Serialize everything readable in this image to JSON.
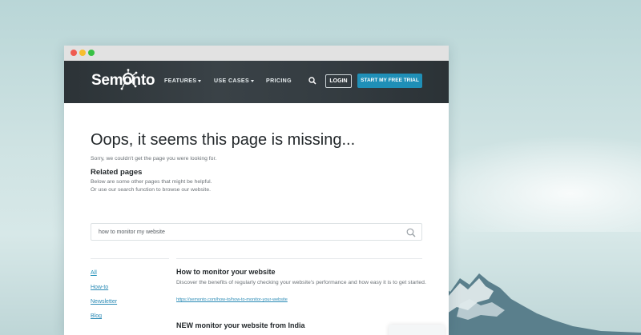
{
  "nav": {
    "brand": "Semonto",
    "features": "FEATURES",
    "use_cases": "USE CASES",
    "pricing": "PRICING",
    "login": "LOGIN",
    "trial": "START MY FREE TRIAL",
    "icons": [
      "logo-network-icon",
      "search-icon",
      "chevron-down-icon"
    ]
  },
  "page": {
    "title": "Oops, it seems this page is missing...",
    "sorry": "Sorry, we couldn't get the page you were looking for.",
    "related_heading": "Related pages",
    "related_line1": "Below are some other pages that might be helpful.",
    "related_line2": "Or use our search function to browse our website."
  },
  "search": {
    "value": "how to monitor my website"
  },
  "filters": [
    {
      "label": "All"
    },
    {
      "label": "How-to"
    },
    {
      "label": "Newsletter"
    },
    {
      "label": "Blog"
    }
  ],
  "results": [
    {
      "title": "How to monitor your website",
      "description": "Discover the benefits of regularly checking your website's performance and how easy it is to get started.",
      "url": "https://semonto.com/how-to/how-to-monitor-your-website"
    },
    {
      "title": "NEW monitor your website from India"
    }
  ],
  "colors": {
    "accent": "#1f8fb7",
    "link": "#2a8ab5",
    "nav_bg": "#343c41",
    "background": "#c6dedf"
  }
}
